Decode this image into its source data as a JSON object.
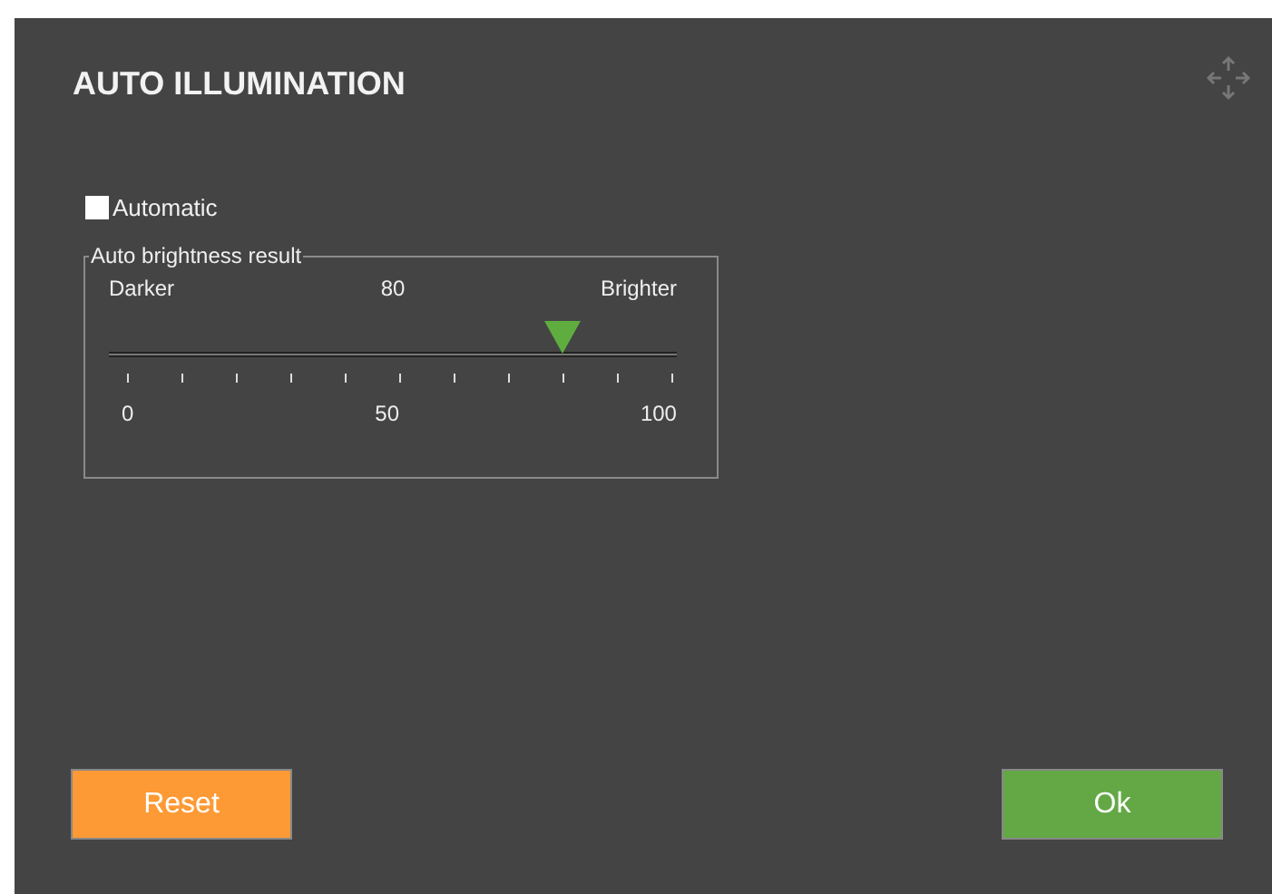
{
  "dialog": {
    "title": "AUTO ILLUMINATION"
  },
  "automatic": {
    "label": "Automatic",
    "checked": false
  },
  "brightness": {
    "legend": "Auto brightness result",
    "min_label": "Darker",
    "reading": "80",
    "max_label": "Brighter",
    "level": 0.8,
    "scale": [
      "0",
      "50",
      "100"
    ]
  },
  "buttons": [
    {
      "kind": "reset",
      "label": "Reset"
    },
    {
      "kind": "ok",
      "label": "Ok"
    }
  ]
}
